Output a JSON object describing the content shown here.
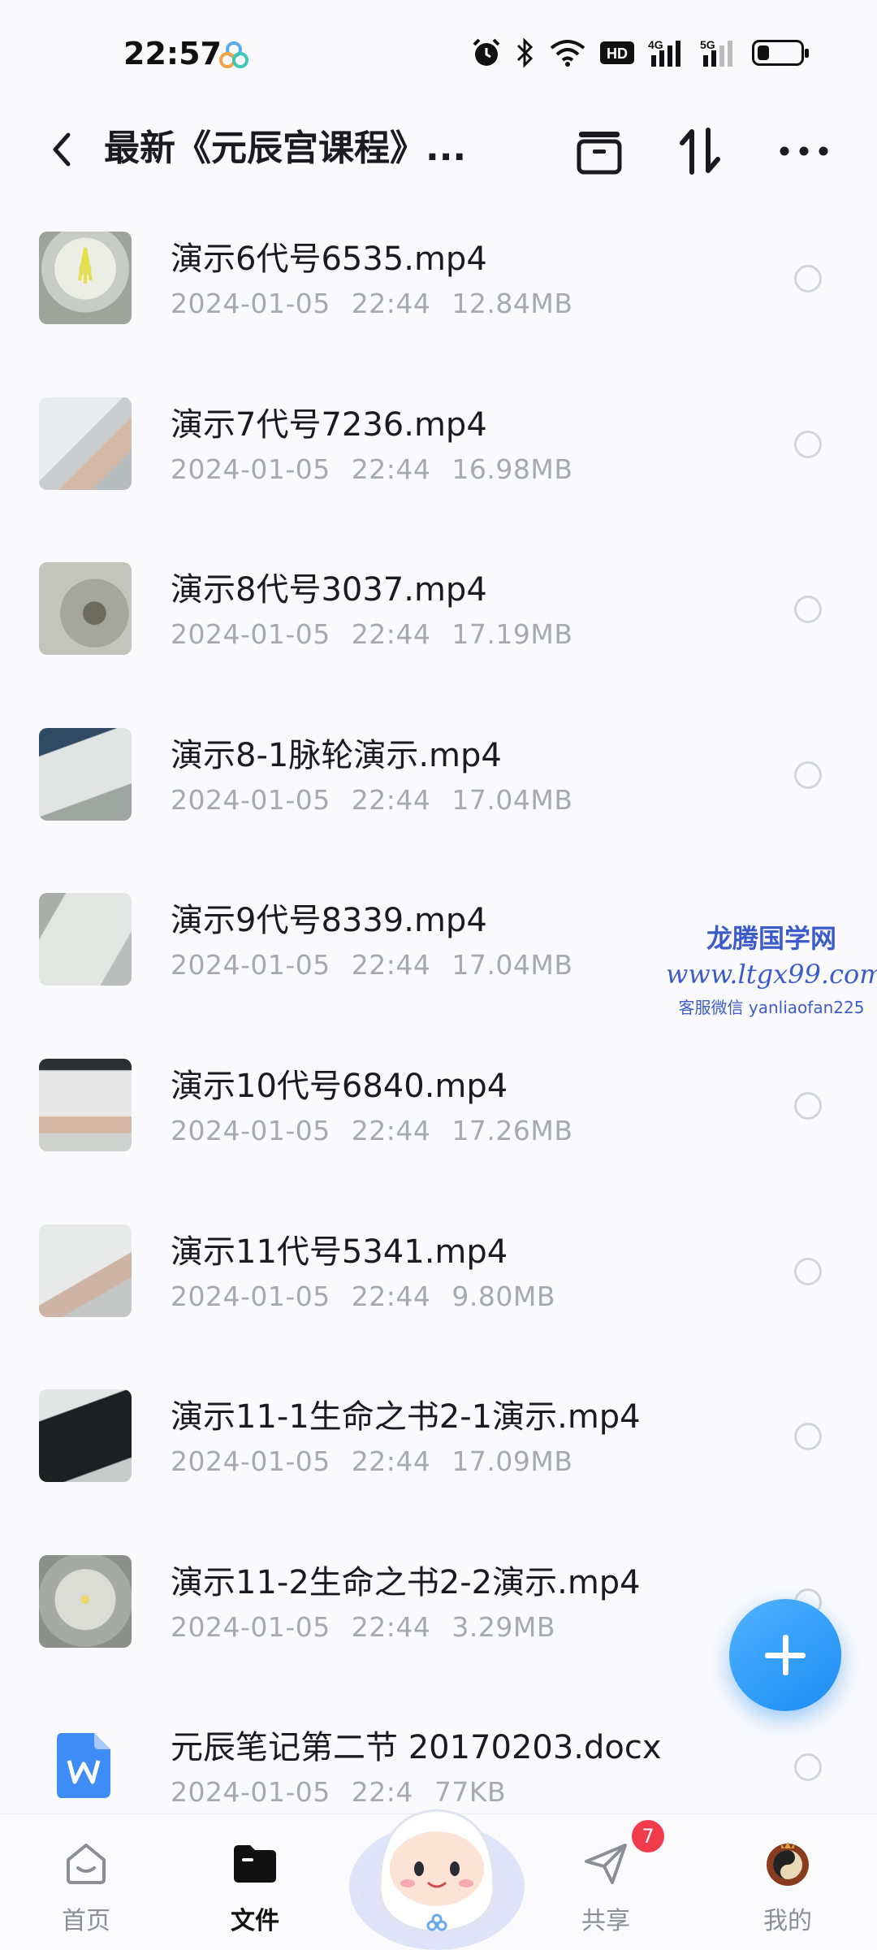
{
  "status_bar": {
    "time": "22:57",
    "network_5g": "5G",
    "network_4g": "4G",
    "hd": "HD"
  },
  "header": {
    "title": "最新《元辰宫课程》...",
    "back_icon": "chevron-left-icon",
    "actions": [
      "folder-icon",
      "sort-icon",
      "more-icon"
    ]
  },
  "files": [
    {
      "name": "演示6代号6535.mp4",
      "date": "2024-01-05",
      "time": "22:44",
      "size": "12.84MB",
      "type": "video"
    },
    {
      "name": "演示7代号7236.mp4",
      "date": "2024-01-05",
      "time": "22:44",
      "size": "16.98MB",
      "type": "video"
    },
    {
      "name": "演示8代号3037.mp4",
      "date": "2024-01-05",
      "time": "22:44",
      "size": "17.19MB",
      "type": "video"
    },
    {
      "name": "演示8-1脉轮演示.mp4",
      "date": "2024-01-05",
      "time": "22:44",
      "size": "17.04MB",
      "type": "video"
    },
    {
      "name": "演示9代号8339.mp4",
      "date": "2024-01-05",
      "time": "22:44",
      "size": "17.04MB",
      "type": "video"
    },
    {
      "name": "演示10代号6840.mp4",
      "date": "2024-01-05",
      "time": "22:44",
      "size": "17.26MB",
      "type": "video"
    },
    {
      "name": "演示11代号5341.mp4",
      "date": "2024-01-05",
      "time": "22:44",
      "size": "9.80MB",
      "type": "video"
    },
    {
      "name": "演示11-1生命之书2-1演示.mp4",
      "date": "2024-01-05",
      "time": "22:44",
      "size": "17.09MB",
      "type": "video"
    },
    {
      "name": "演示11-2生命之书2-2演示.mp4",
      "date": "2024-01-05",
      "time": "22:44",
      "size": "3.29MB",
      "type": "video"
    },
    {
      "name": "元辰笔记第二节 20170203.docx",
      "date": "2024-01-05",
      "time": "22:4",
      "size": "77KB",
      "type": "doc"
    }
  ],
  "watermark": {
    "line1": "龙腾国学网",
    "line2": "www.ltgx99.com",
    "line3": "客服微信 yanliaofan225"
  },
  "fab": {
    "icon": "plus-icon"
  },
  "bottom_nav": [
    {
      "label": "首页",
      "icon": "home-icon",
      "active": false
    },
    {
      "label": "文件",
      "icon": "folder-icon",
      "active": true
    },
    {
      "label": "共享",
      "icon": "send-icon",
      "active": false,
      "badge": "7"
    },
    {
      "label": "我的",
      "icon": "avatar-icon",
      "active": false
    }
  ],
  "colors": {
    "accent": "#1c8cf4",
    "badge": "#f23b4a",
    "meta_text": "#a7a9b0",
    "watermark": "#3d5cc9"
  }
}
